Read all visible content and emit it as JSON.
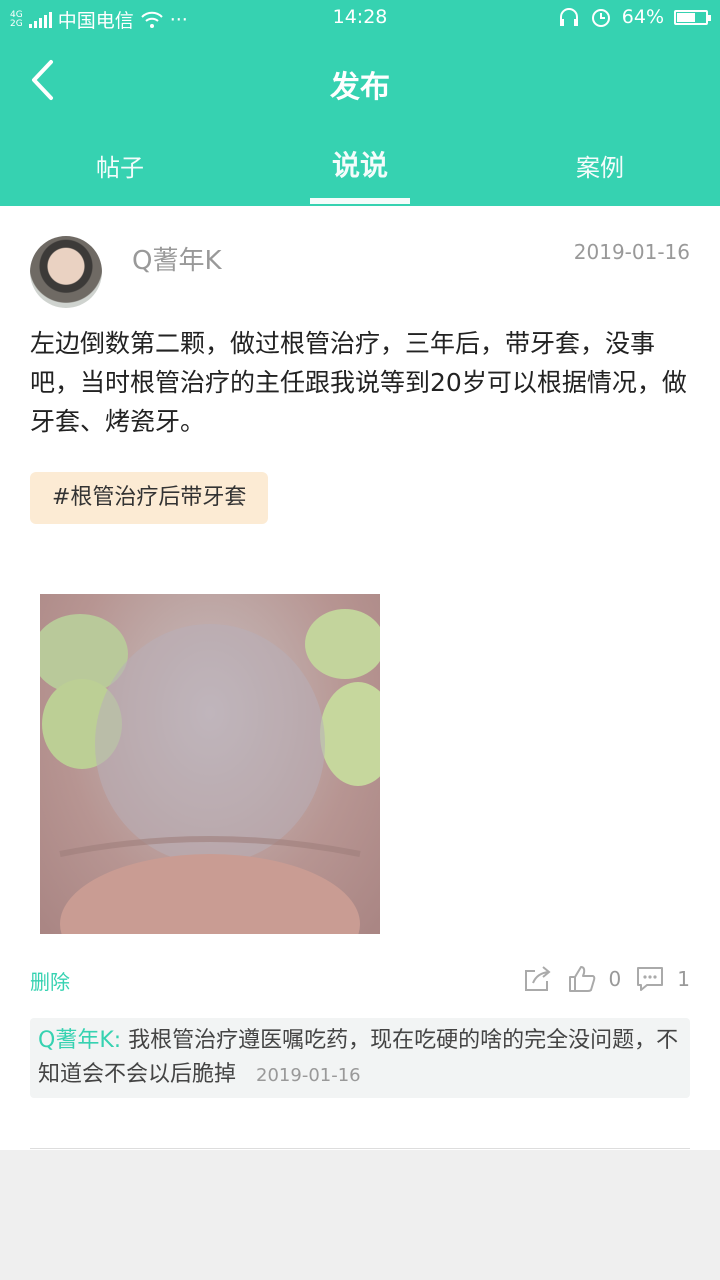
{
  "status_bar": {
    "network": "4G\n2G",
    "carrier": "中国电信",
    "more": "···",
    "time": "14:28",
    "battery_percent_text": "64%",
    "battery_level": 0.64
  },
  "header": {
    "title": "发布"
  },
  "tabs": [
    {
      "label": "帖子"
    },
    {
      "label": "说说"
    },
    {
      "label": "案例"
    }
  ],
  "post": {
    "username": "Q蓍年K",
    "date": "2019-01-16",
    "text": "左边倒数第二颗，做过根管治疗，三年后，带牙套，没事吧，当时根管治疗的主任跟我说等到20岁可以根据情况，做牙套、烤瓷牙。",
    "tag": "#根管治疗后带牙套",
    "delete_label": "删除",
    "like_count": "0",
    "comment_count": "1"
  },
  "comment": {
    "author": "Q蓍年K",
    "separator": ": ",
    "text": "我根管治疗遵医嘱吃药，现在吃硬的啥的完全没问题，不知道会不会以后脆掉",
    "date": "2019-01-16"
  },
  "colors": {
    "accent": "#36d2b1",
    "tag_bg": "#fcebd4"
  }
}
